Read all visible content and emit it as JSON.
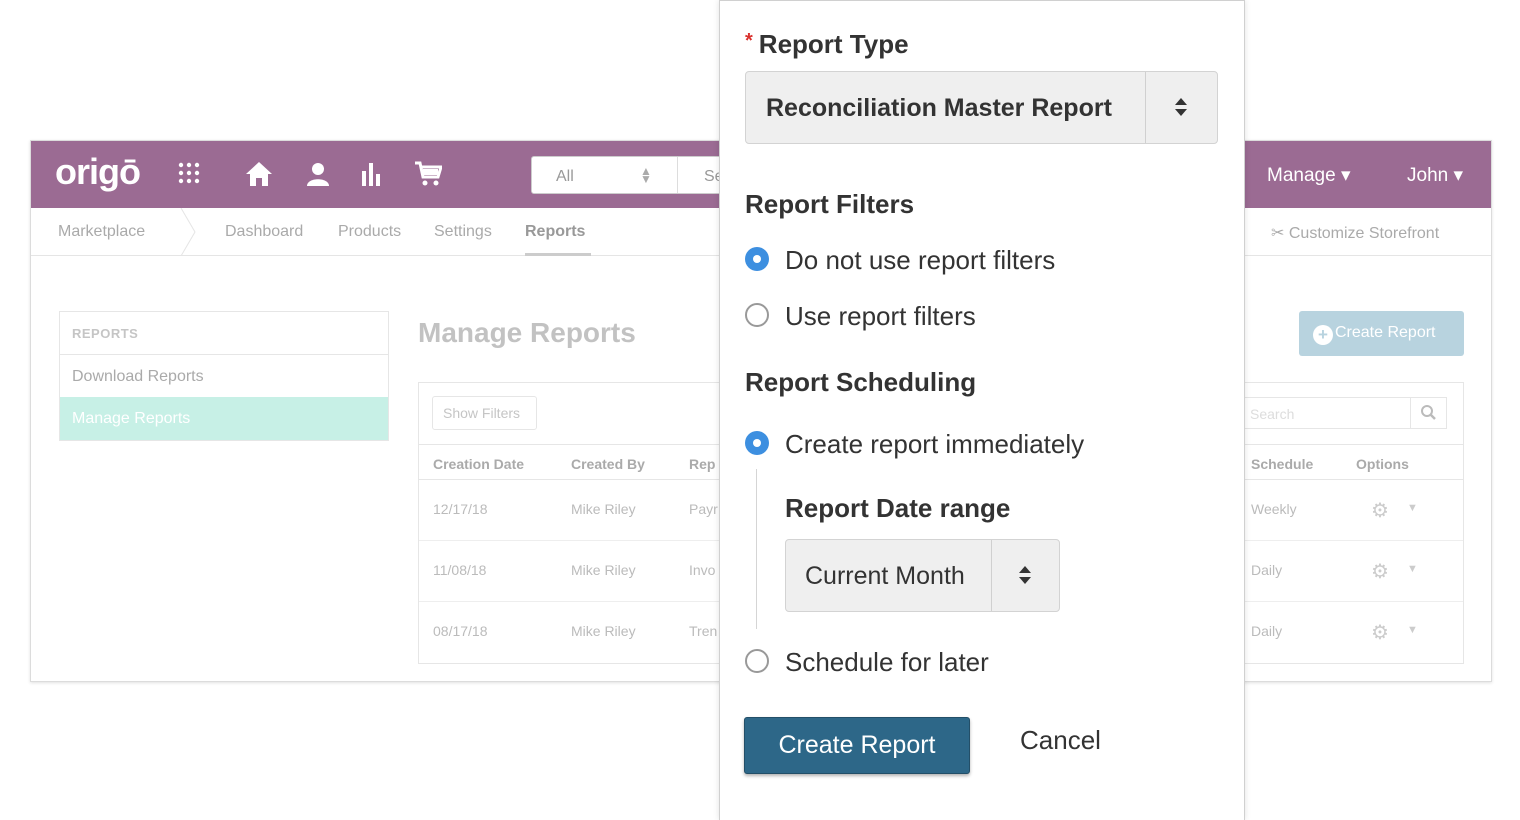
{
  "app": {
    "logo": "origō",
    "search": {
      "scope": "All",
      "placeholder": "Se"
    },
    "top_menu": {
      "manage": "Manage ▾",
      "user": "John ▾"
    },
    "subnav": {
      "items": [
        "Marketplace",
        "Dashboard",
        "Products",
        "Settings",
        "Reports"
      ],
      "active": "Reports",
      "customize": "Customize Storefront"
    },
    "sidebar": {
      "heading": "REPORTS",
      "items": [
        "Download Reports",
        "Manage Reports"
      ]
    },
    "page_title": "Manage Reports",
    "create_button": "Create Report",
    "table": {
      "show_filters": "Show Filters",
      "search_placeholder": "Search",
      "columns": [
        "Creation Date",
        "Created By",
        "Rep",
        "Schedule",
        "Options"
      ],
      "rows": [
        {
          "date": "12/17/18",
          "by": "Mike Riley",
          "report": "Payr",
          "schedule": "Weekly"
        },
        {
          "date": "11/08/18",
          "by": "Mike Riley",
          "report": "Invo",
          "schedule": "Daily"
        },
        {
          "date": "08/17/18",
          "by": "Mike Riley",
          "report": "Tren",
          "schedule": "Daily"
        }
      ]
    }
  },
  "modal": {
    "required_mark": "*",
    "report_type_label": "Report Type",
    "report_type_value": "Reconciliation Master Report",
    "filters_heading": "Report Filters",
    "filter_options": [
      "Do not use report filters",
      "Use report filters"
    ],
    "filter_selected": 0,
    "scheduling_heading": "Report Scheduling",
    "schedule_options": [
      "Create report immediately",
      "Schedule for later"
    ],
    "schedule_selected": 0,
    "date_range_label": "Report Date range",
    "date_range_value": "Current Month",
    "create_button": "Create Report",
    "cancel_button": "Cancel"
  },
  "colors": {
    "topbar": "#9b6b93",
    "primary_button": "#2d6788",
    "radio_selected": "#3d8fe0",
    "required": "#d9302c",
    "sidebar_active": "#c7f0e6"
  }
}
